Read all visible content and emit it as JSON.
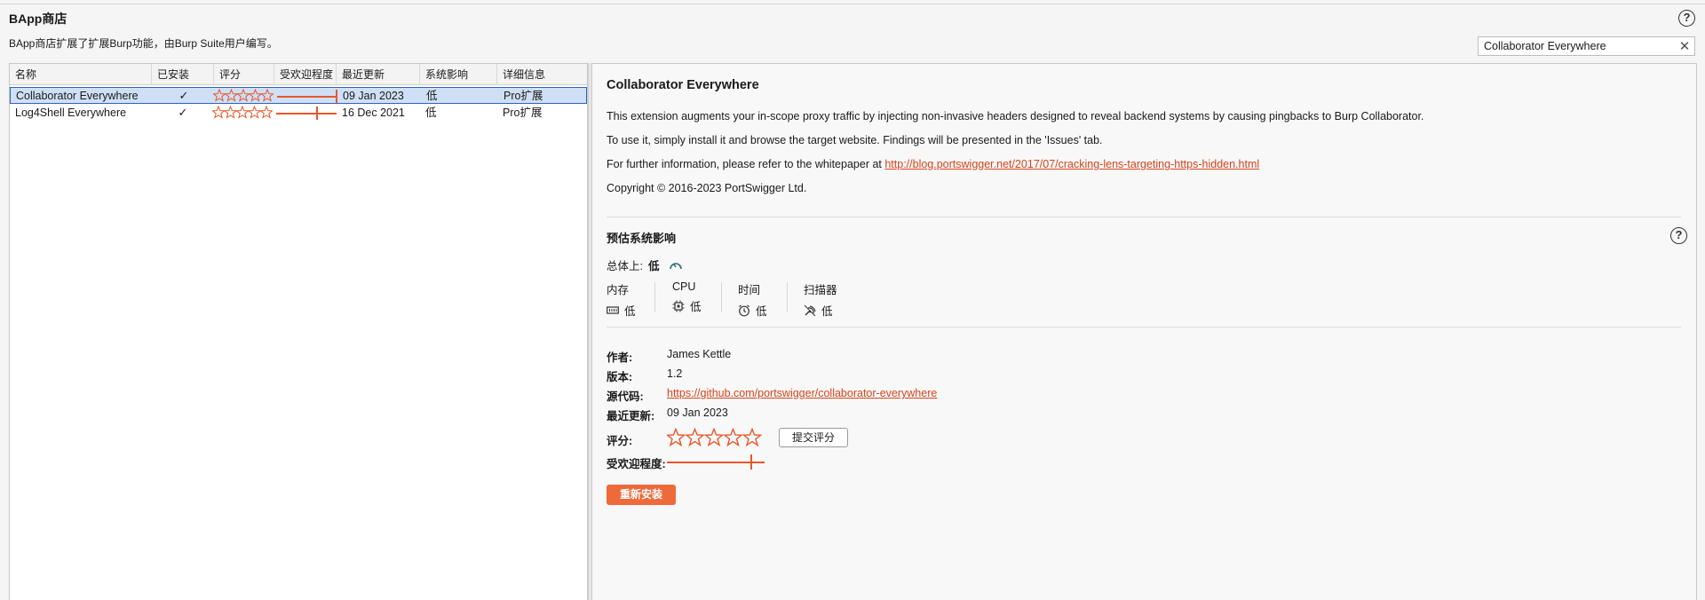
{
  "app": {
    "title": "BApp商店",
    "description": "BApp商店扩展了扩展Burp功能，由Burp Suite用户编写。",
    "help_glyph": "?"
  },
  "search": {
    "value": "Collaborator Everywhere",
    "clear_glyph": "✕"
  },
  "table": {
    "columns": [
      "名称",
      "已安装",
      "评分",
      "受欢迎程度",
      "最近更新",
      "系统影响",
      "详细信息"
    ],
    "rows": [
      {
        "name": "Collaborator Everywhere",
        "installed": "✓",
        "rating": 0,
        "popularity": 1.0,
        "updated": "09 Jan 2023",
        "impact": "低",
        "details": "Pro扩展",
        "selected": true
      },
      {
        "name": "Log4Shell Everywhere",
        "installed": "✓",
        "rating": 0,
        "popularity": 0.68,
        "updated": "16 Dec 2021",
        "impact": "低",
        "details": "Pro扩展",
        "selected": false
      }
    ]
  },
  "detail": {
    "name": "Collaborator Everywhere",
    "paragraphs": [
      "This extension augments your in-scope proxy traffic by injecting non-invasive headers designed to reveal backend systems by causing pingbacks to Burp Collaborator.",
      "To use it, simply install it and browse the target website. Findings will be presented in the 'Issues' tab."
    ],
    "whitepaper_prefix": "For further information, please refer to the whitepaper at ",
    "whitepaper_link": "http://blog.portswigger.net/2017/07/cracking-lens-targeting-https-hidden.html",
    "copyright": "Copyright © 2016-2023 PortSwigger Ltd.",
    "impact_section": {
      "title": "预估系统影响",
      "overall_label": "总体上:",
      "overall_value": "低",
      "items": [
        {
          "label": "内存",
          "value": "低",
          "icon": "memory-icon"
        },
        {
          "label": "CPU",
          "value": "低",
          "icon": "cpu-icon"
        },
        {
          "label": "时间",
          "value": "低",
          "icon": "clock-icon"
        },
        {
          "label": "扫描器",
          "value": "低",
          "icon": "scanner-icon"
        }
      ]
    },
    "meta": {
      "author_label": "作者:",
      "author": "James Kettle",
      "version_label": "版本:",
      "version": "1.2",
      "source_label": "源代码:",
      "source": "https://github.com/portswigger/collaborator-everywhere",
      "updated_label": "最近更新:",
      "updated": "09 Jan 2023",
      "rating_label": "评分:",
      "rating": 0,
      "submit_rating": "提交评分",
      "popularity_label": "受欢迎程度:",
      "popularity": 0.85
    },
    "reinstall_label": "重新安装"
  },
  "colors": {
    "accent": "#ee6a3b",
    "link": "#d5441c",
    "selection": "#cfe0f6"
  }
}
